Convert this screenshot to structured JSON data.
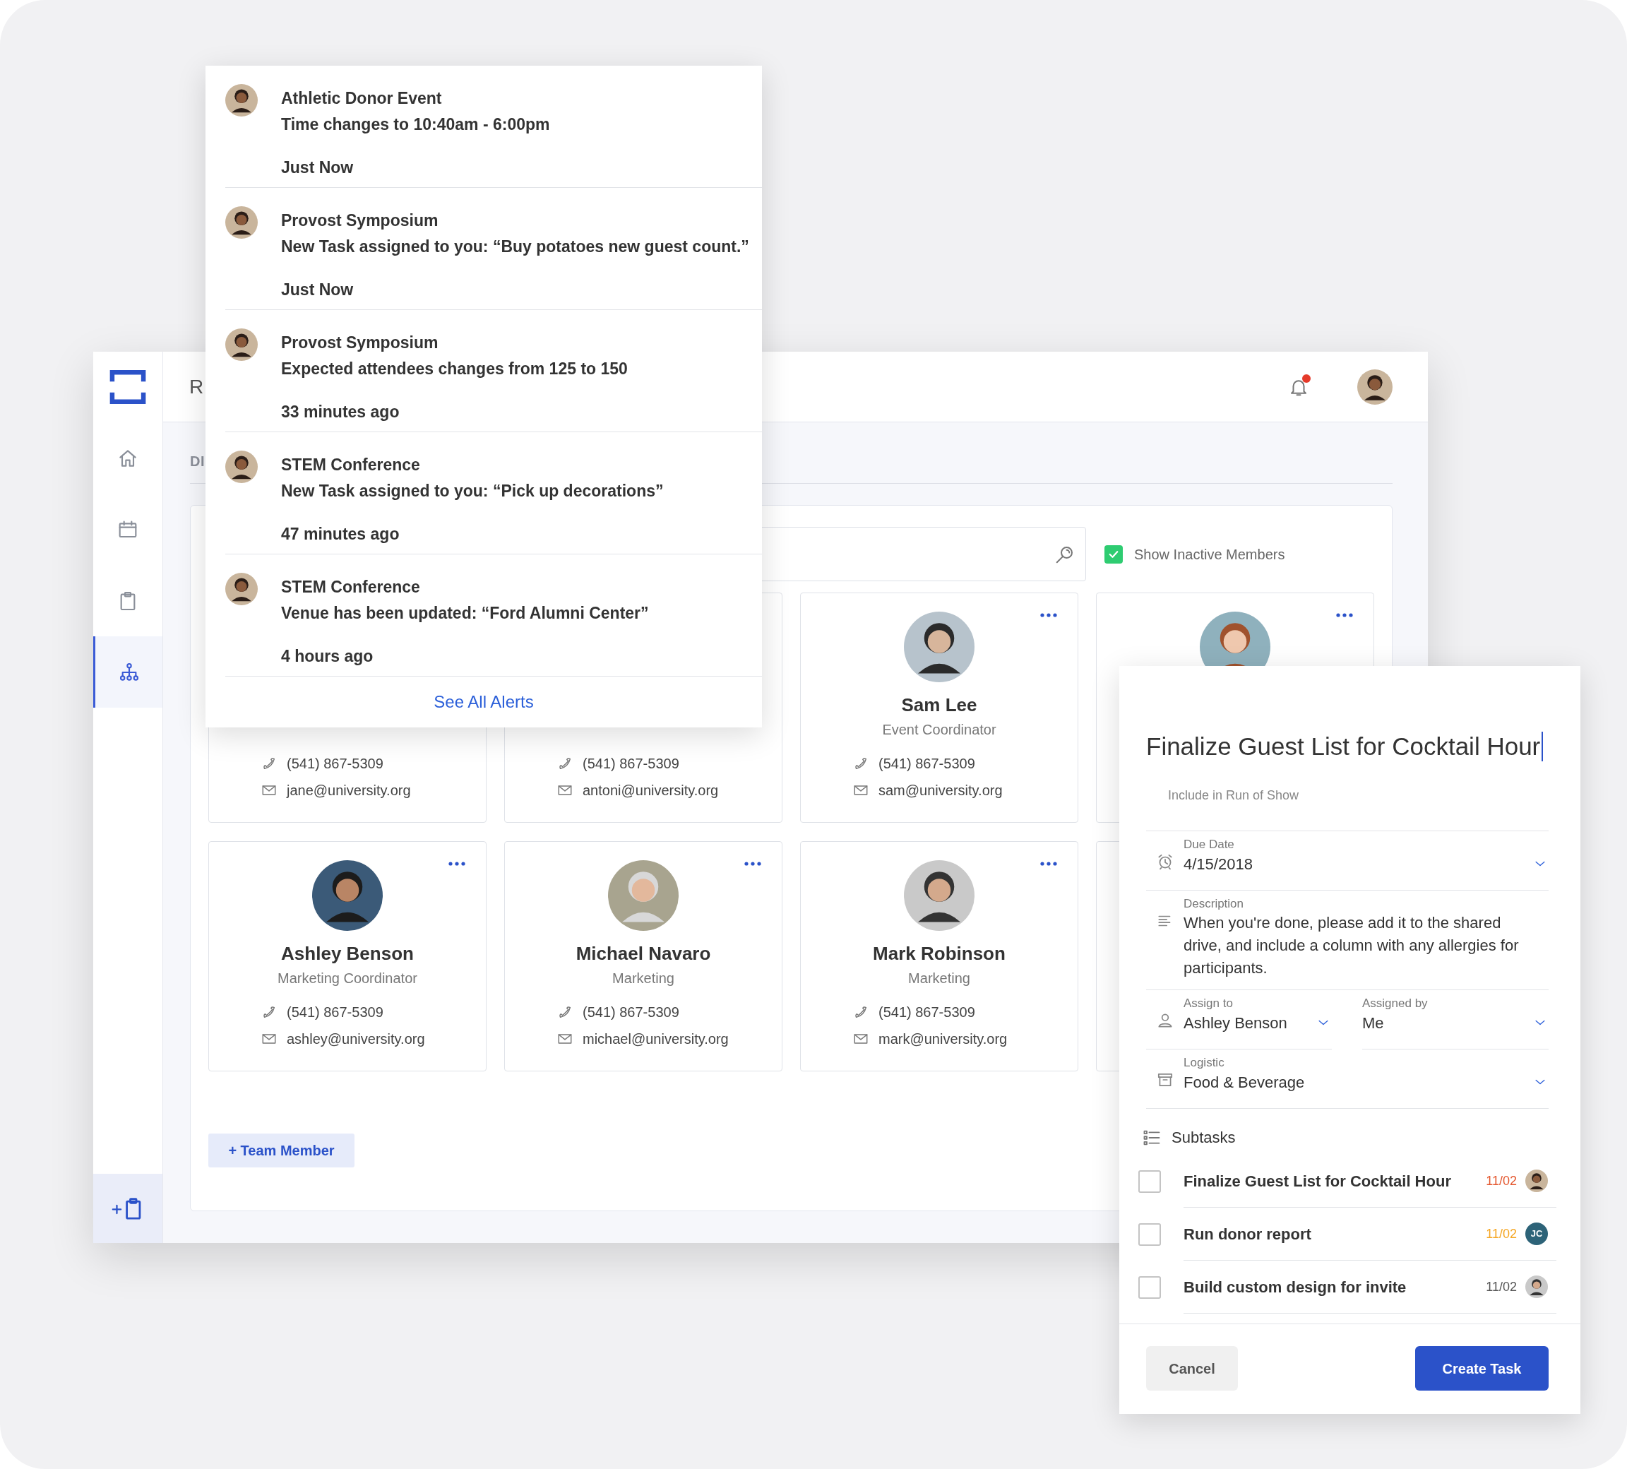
{
  "sidebar": {
    "items": [
      {
        "kind": "home",
        "selected": false
      },
      {
        "kind": "calendar",
        "selected": false
      },
      {
        "kind": "clipboard",
        "selected": false
      },
      {
        "kind": "org",
        "selected": true
      }
    ]
  },
  "topbar": {
    "title": "R",
    "notifications_unread": true
  },
  "section_heading": "DI",
  "show_inactive": {
    "label": "Show Inactive Members",
    "checked": true
  },
  "members": [
    {
      "avatar": false,
      "menu": false,
      "phone": "(541) 867-5309",
      "email": "jane@university.org"
    },
    {
      "avatar": false,
      "menu": false,
      "phone": "(541) 867-5309",
      "email": "antoni@university.org"
    },
    {
      "avatar": true,
      "menu": true,
      "name": "Sam Lee",
      "role": "Event Coordinator",
      "phone": "(541) 867-5309",
      "email": "sam@university.org"
    },
    {
      "avatar": true,
      "menu": true
    },
    {
      "avatar": true,
      "menu": true,
      "name": "Ashley Benson",
      "role": "Marketing Coordinator",
      "phone": "(541) 867-5309",
      "email": "ashley@university.org"
    },
    {
      "avatar": true,
      "menu": true,
      "name": "Michael Navaro",
      "role": "Marketing",
      "phone": "(541) 867-5309",
      "email": "michael@university.org"
    },
    {
      "avatar": true,
      "menu": true,
      "name": "Mark Robinson",
      "role": "Marketing",
      "phone": "(541) 867-5309",
      "email": "mark@university.org"
    },
    {
      "avatar": false,
      "menu": false
    }
  ],
  "add_member_button": "+ Team Member",
  "notifications": {
    "items": [
      {
        "event": "Athletic Donor Event",
        "message": "Time changes to 10:40am - 6:00pm",
        "time": "Just Now"
      },
      {
        "event": "Provost Symposium",
        "message": "New Task assigned to you: “Buy potatoes new guest count.”",
        "time": "Just Now"
      },
      {
        "event": "Provost Symposium",
        "message": "Expected attendees changes from 125 to 150",
        "time": "33 minutes ago"
      },
      {
        "event": "STEM Conference",
        "message": "New Task assigned to you: “Pick up decorations”",
        "time": "47 minutes ago"
      },
      {
        "event": "STEM Conference",
        "message": "Venue has been updated: “Ford Alumni Center”",
        "time": "4 hours ago"
      }
    ],
    "see_all": "See All Alerts"
  },
  "task": {
    "title": "Finalize Guest List for Cocktail Hour",
    "include_label": "Include in Run of Show",
    "due_date": {
      "label": "Due Date",
      "value": "4/15/2018"
    },
    "description": {
      "label": "Description",
      "value": "When you're done, please add it to the shared drive, and include a column with any allergies for participants."
    },
    "assign_to": {
      "label": "Assign to",
      "value": "Ashley Benson"
    },
    "assigned_by": {
      "label": "Assigned by",
      "value": "Me"
    },
    "logistic": {
      "label": "Logistic",
      "value": "Food & Beverage"
    },
    "subtasks_heading": "Subtasks",
    "subtasks": [
      {
        "title": "Finalize Guest List for Cocktail Hour",
        "checked": false,
        "date": "11/02",
        "color": "#e4572e",
        "avatar": {
          "kind": "photo"
        }
      },
      {
        "title": "Run donor report",
        "checked": false,
        "date": "11/02",
        "color": "#f5a623",
        "avatar": {
          "kind": "initials",
          "initials": "JC"
        }
      },
      {
        "title": "Build custom design for invite",
        "checked": false,
        "date": "11/02",
        "color": "#555555",
        "avatar": {
          "kind": "photo"
        }
      }
    ],
    "cancel_button": "Cancel",
    "create_button": "Create Task"
  }
}
